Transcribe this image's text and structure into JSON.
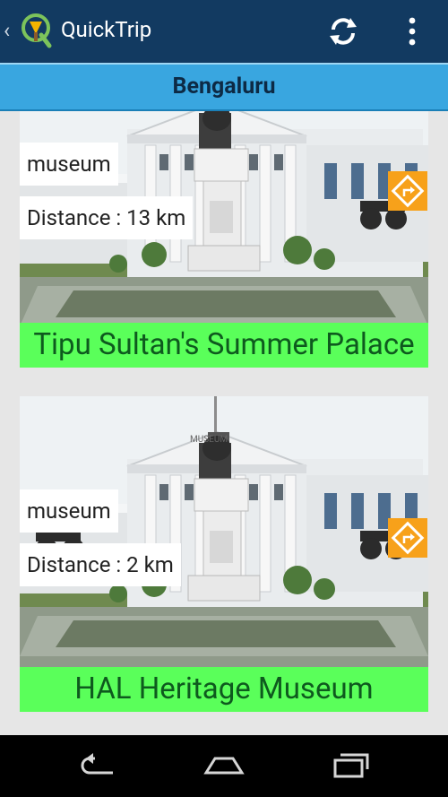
{
  "app": {
    "title": "QuickTrip",
    "back_icon": "chevron-left-icon",
    "logo_icon": "quicktrip-logo-icon",
    "refresh_icon": "refresh-icon",
    "menu_icon": "overflow-menu-icon"
  },
  "location": {
    "name": "Bengaluru"
  },
  "places": [
    {
      "category": "museum",
      "distance": "Distance : 13 km",
      "name": "Tipu Sultan's Summer Palace",
      "photo_text": ""
    },
    {
      "category": "museum",
      "distance": "Distance : 2 km",
      "name": "HAL Heritage Museum",
      "photo_text": "MUSEUM"
    }
  ],
  "colors": {
    "app_bar": "#123a61",
    "location_bar": "#39a6e0",
    "name_bar": "#5aff5a",
    "nav_button": "#f7a11a"
  },
  "system_nav": {
    "back_icon": "back-icon",
    "home_icon": "home-icon",
    "recents_icon": "recents-icon"
  }
}
